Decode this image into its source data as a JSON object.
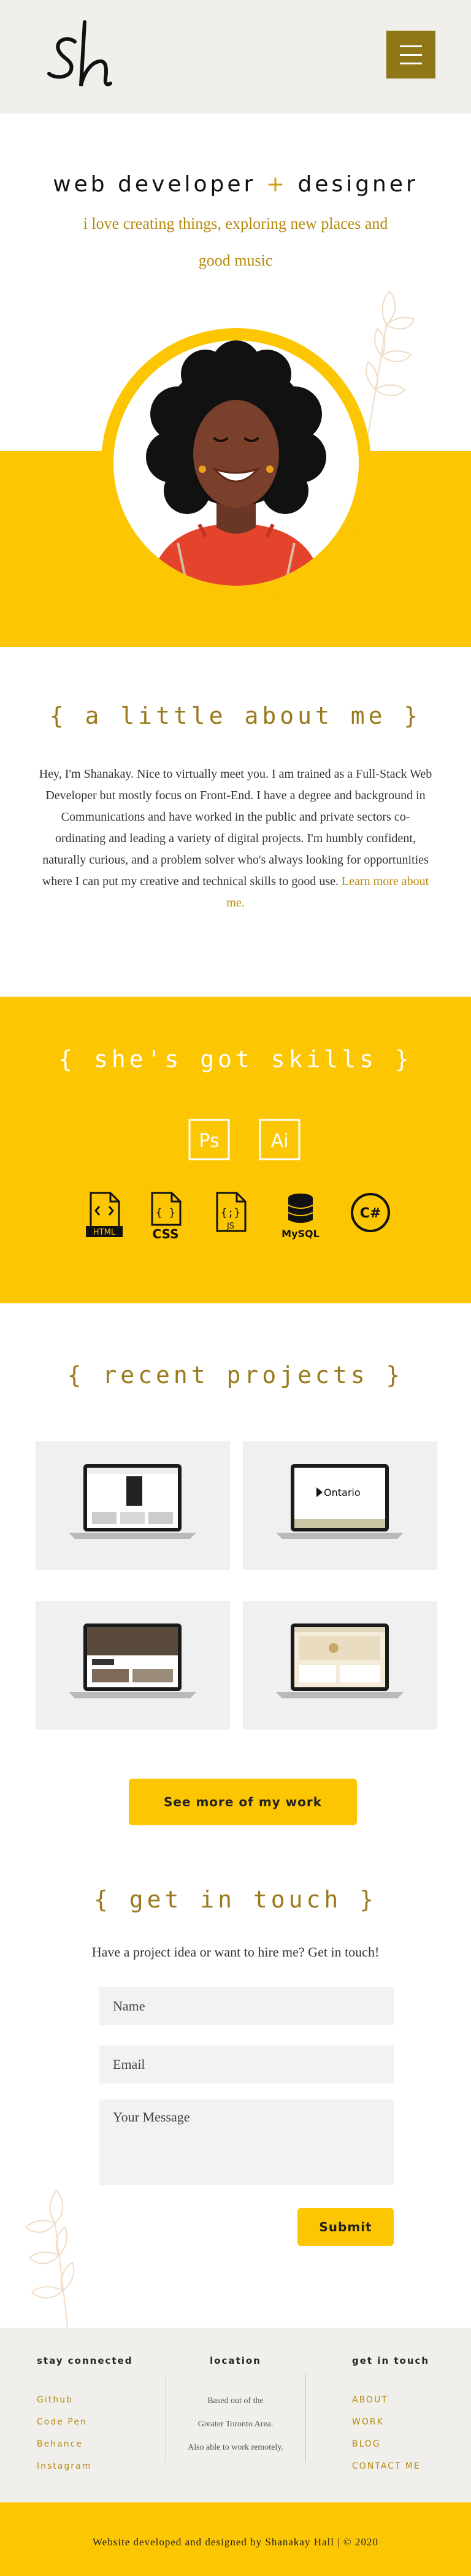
{
  "colors": {
    "accent": "#fdc602",
    "gold": "#9a7a1c",
    "header_bg": "#f0efeb",
    "menu_button": "#8f7717"
  },
  "header": {
    "logo_text": "sh",
    "menu_icon": "hamburger-menu-icon"
  },
  "hero": {
    "title_part1": "web developer",
    "title_plus": "+",
    "title_part2": "designer",
    "subtitle": "i love creating things, exploring new places and good music"
  },
  "about": {
    "title": "{ a little about me }",
    "text": "Hey, I'm Shanakay. Nice to virtually meet you. I am trained as a Full-Stack Web Developer but mostly focus on Front-End. I have a degree and background in Communications and have worked in the public and private sectors co-ordinating and leading a variety of digital projects. I'm humbly confident, naturally curious, and a problem solver who's always looking for opportunities where I can put my creative and technical skills to good use.",
    "link": "Learn more about me."
  },
  "skills": {
    "title": "{ she's got skills }",
    "items": [
      {
        "label": "Ps",
        "icon": "photoshop-icon"
      },
      {
        "label": "Ai",
        "icon": "illustrator-icon"
      },
      {
        "label": "HTML",
        "icon": "html-file-icon"
      },
      {
        "label": "CSS",
        "icon": "css-file-icon"
      },
      {
        "label": "JS",
        "icon": "js-file-icon"
      },
      {
        "label": "MySQL",
        "icon": "mysql-database-icon"
      },
      {
        "label": "C#",
        "icon": "csharp-icon"
      }
    ]
  },
  "projects": {
    "title": "{ recent projects }",
    "items": [
      {
        "screen_text": ""
      },
      {
        "screen_text": "Ontario"
      },
      {
        "screen_text": ""
      },
      {
        "screen_text": ""
      }
    ],
    "more_button": "See more of my work"
  },
  "contact": {
    "title": "{ get in touch }",
    "subtitle": "Have a project idea or want to hire me? Get in touch!",
    "name_placeholder": "Name",
    "email_placeholder": "Email",
    "message_placeholder": "Your Message",
    "submit": "Submit"
  },
  "footer": {
    "col1_title": "stay connected",
    "col1_links": [
      "Github",
      "Code Pen",
      "Behance",
      "Instagram"
    ],
    "col2_title": "location",
    "col2_lines": [
      "Based out of the",
      "Greater Toronto Area.",
      "Also able to work remotely."
    ],
    "col3_title": "get in touch",
    "col3_links": [
      "ABOUT",
      "WORK",
      "BLOG",
      "CONTACT ME"
    ],
    "copyright": "Website developed and designed by Shanakay Hall | © 2020"
  }
}
